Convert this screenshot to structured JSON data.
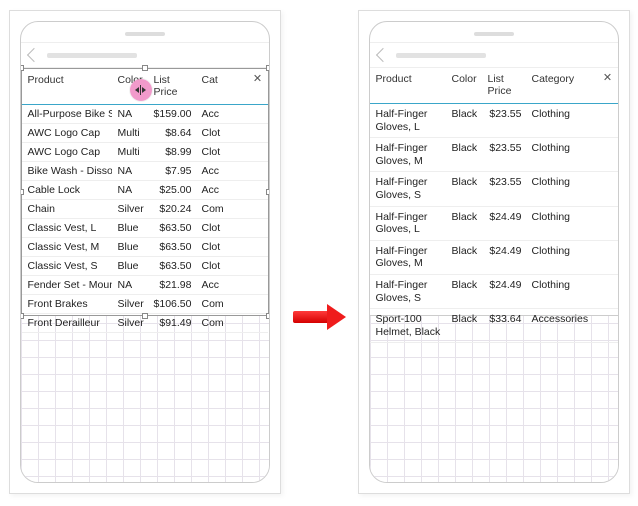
{
  "headers": {
    "product": "Product",
    "color": "Color",
    "price": "List Price",
    "category": "Category",
    "category_truncated": "Cat"
  },
  "left_rows": [
    {
      "product": "All-Purpose Bike Stand",
      "color": "NA",
      "price": "$159.00",
      "cat": "Acc"
    },
    {
      "product": "AWC Logo Cap",
      "color": "Multi",
      "price": "$8.64",
      "cat": "Clot"
    },
    {
      "product": "AWC Logo Cap",
      "color": "Multi",
      "price": "$8.99",
      "cat": "Clot"
    },
    {
      "product": "Bike Wash - Dissolver",
      "color": "NA",
      "price": "$7.95",
      "cat": "Acc"
    },
    {
      "product": "Cable Lock",
      "color": "NA",
      "price": "$25.00",
      "cat": "Acc"
    },
    {
      "product": "Chain",
      "color": "Silver",
      "price": "$20.24",
      "cat": "Com"
    },
    {
      "product": "Classic Vest, L",
      "color": "Blue",
      "price": "$63.50",
      "cat": "Clot"
    },
    {
      "product": "Classic Vest, M",
      "color": "Blue",
      "price": "$63.50",
      "cat": "Clot"
    },
    {
      "product": "Classic Vest, S",
      "color": "Blue",
      "price": "$63.50",
      "cat": "Clot"
    },
    {
      "product": "Fender Set - Mountain",
      "color": "NA",
      "price": "$21.98",
      "cat": "Acc"
    },
    {
      "product": "Front Brakes",
      "color": "Silver",
      "price": "$106.50",
      "cat": "Com"
    },
    {
      "product": "Front Derailleur",
      "color": "Silver",
      "price": "$91.49",
      "cat": "Com"
    }
  ],
  "right_rows": [
    {
      "product": "Half-Finger Gloves, L",
      "color": "Black",
      "price": "$23.55",
      "cat": "Clothing"
    },
    {
      "product": "Half-Finger Gloves, M",
      "color": "Black",
      "price": "$23.55",
      "cat": "Clothing"
    },
    {
      "product": "Half-Finger Gloves, S",
      "color": "Black",
      "price": "$23.55",
      "cat": "Clothing"
    },
    {
      "product": "Half-Finger Gloves, L",
      "color": "Black",
      "price": "$24.49",
      "cat": "Clothing"
    },
    {
      "product": "Half-Finger Gloves, M",
      "color": "Black",
      "price": "$24.49",
      "cat": "Clothing"
    },
    {
      "product": "Half-Finger Gloves, S",
      "color": "Black",
      "price": "$24.49",
      "cat": "Clothing"
    },
    {
      "product": "Sport-100 Helmet, Black",
      "color": "Black",
      "price": "$33.64",
      "cat": "Accessories"
    }
  ]
}
